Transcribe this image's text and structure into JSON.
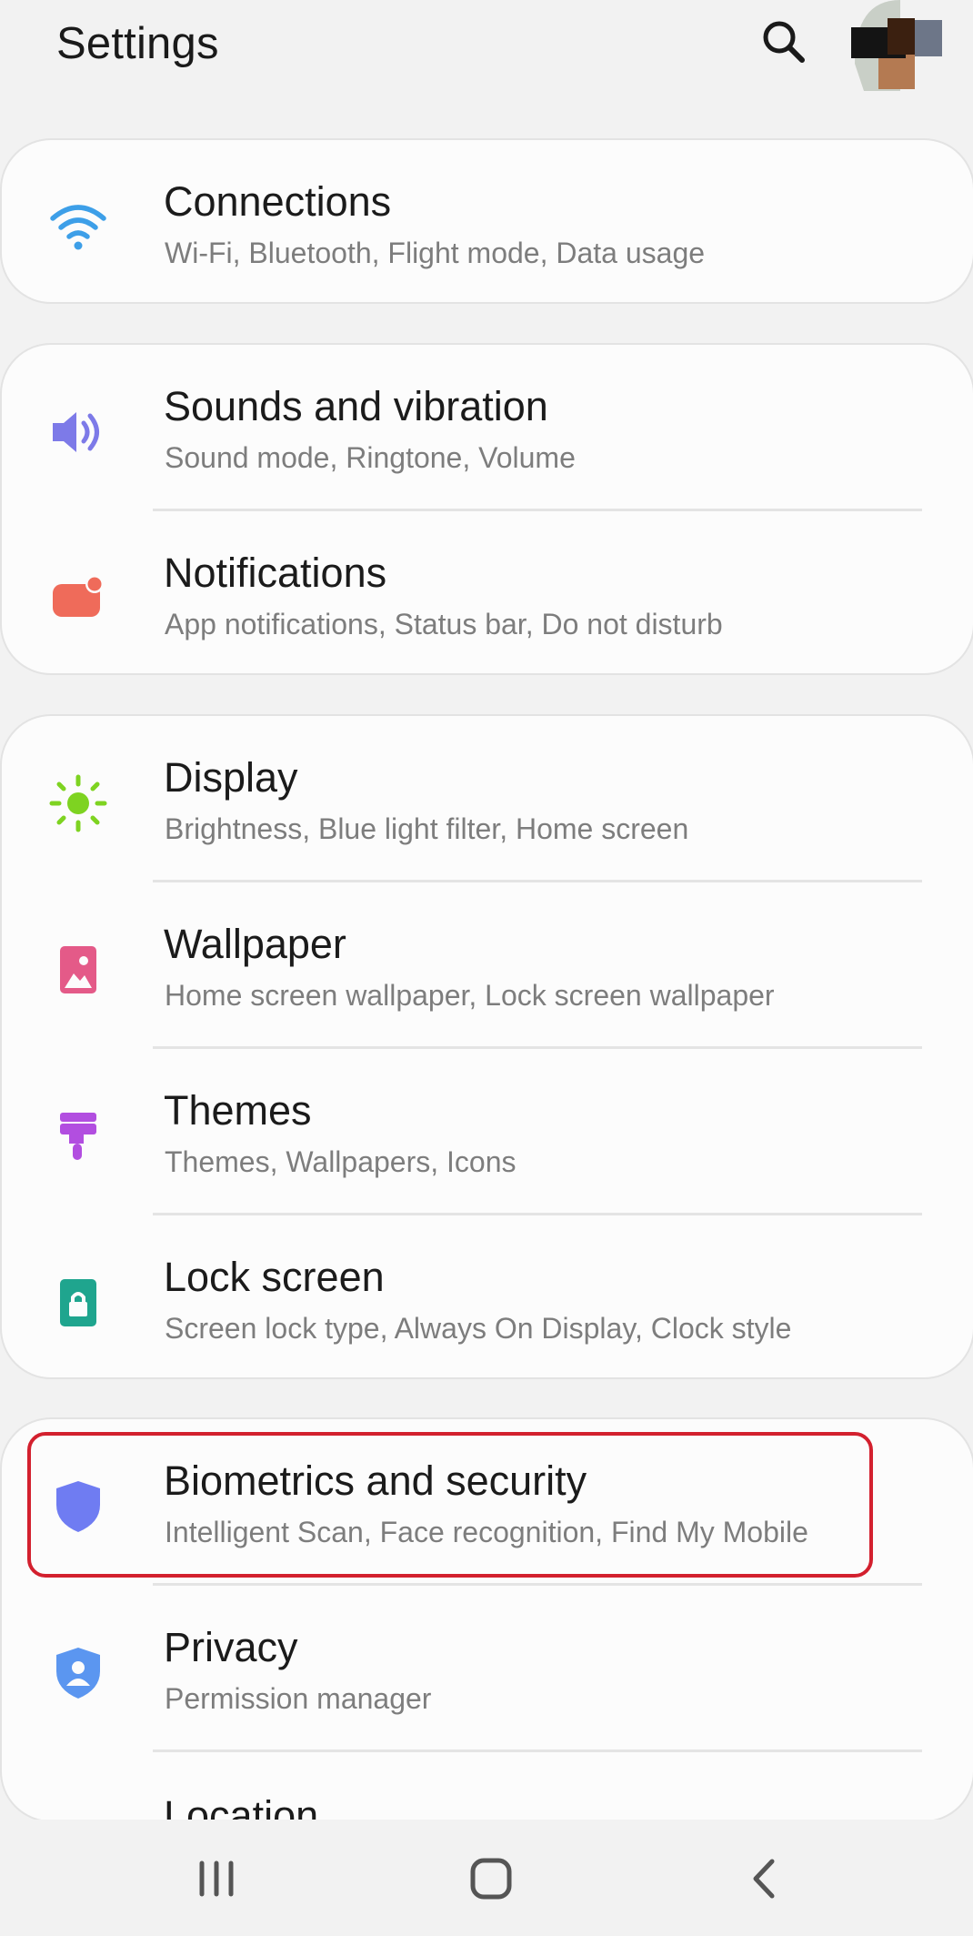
{
  "header": {
    "title": "Settings",
    "search_icon": "search-icon",
    "avatar_icon": "avatar"
  },
  "settings": [
    {
      "id": "connections",
      "title": "Connections",
      "subtitle": "Wi-Fi, Bluetooth, Flight mode, Data usage",
      "icon": "wifi-icon",
      "color": "#3d9fe8"
    },
    {
      "id": "sounds",
      "title": "Sounds and vibration",
      "subtitle": "Sound mode, Ringtone, Volume",
      "icon": "volume-icon",
      "color": "#7d7ae8"
    },
    {
      "id": "notifications",
      "title": "Notifications",
      "subtitle": "App notifications, Status bar, Do not disturb",
      "icon": "notification-icon",
      "color": "#ef6b5a"
    },
    {
      "id": "display",
      "title": "Display",
      "subtitle": "Brightness, Blue light filter, Home screen",
      "icon": "brightness-icon",
      "color": "#7ed321"
    },
    {
      "id": "wallpaper",
      "title": "Wallpaper",
      "subtitle": "Home screen wallpaper, Lock screen wallpaper",
      "icon": "wallpaper-icon",
      "color": "#e45a88"
    },
    {
      "id": "themes",
      "title": "Themes",
      "subtitle": "Themes, Wallpapers, Icons",
      "icon": "themes-brush-icon",
      "color": "#b24ee0"
    },
    {
      "id": "lockscreen",
      "title": "Lock screen",
      "subtitle": "Screen lock type, Always On Display, Clock style",
      "icon": "lock-icon",
      "color": "#1fa58e"
    },
    {
      "id": "biometrics",
      "title": "Biometrics and security",
      "subtitle": "Intelligent Scan, Face recognition, Find My Mobile",
      "icon": "shield-icon",
      "color": "#6f7cf2"
    },
    {
      "id": "privacy",
      "title": "Privacy",
      "subtitle": "Permission manager",
      "icon": "privacy-shield-icon",
      "color": "#5b96f0"
    },
    {
      "id": "location",
      "title": "Location",
      "subtitle": "",
      "icon": "location-icon",
      "color": "#3bb84a"
    }
  ],
  "nav": {
    "recents_icon": "recents-icon",
    "home_icon": "home-icon",
    "back_icon": "back-icon"
  },
  "highlight_color": "#d3202e"
}
